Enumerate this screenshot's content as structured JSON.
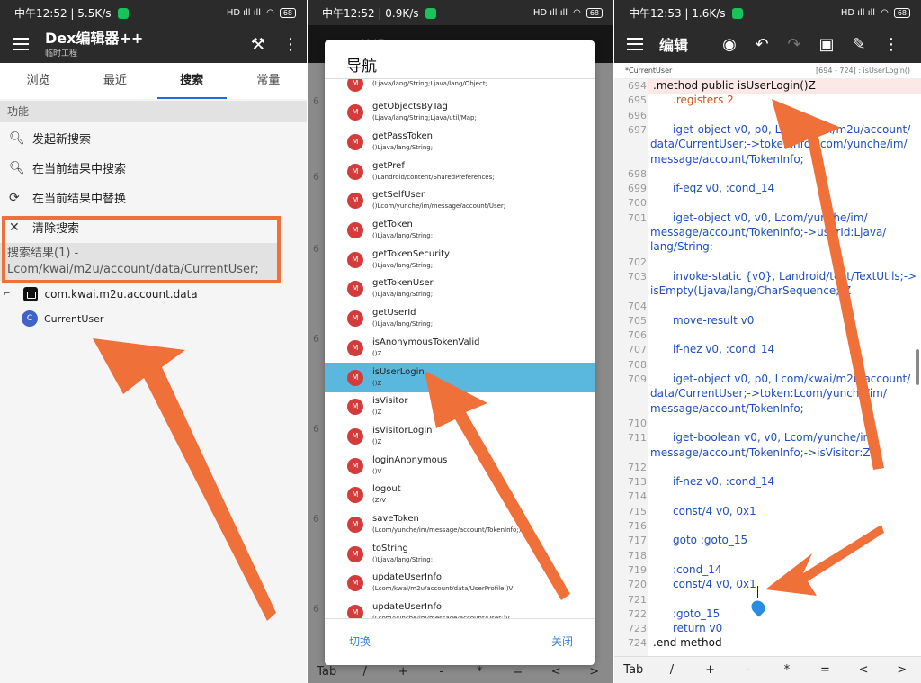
{
  "panel1": {
    "status": {
      "time": "中午12:52 | 5.5K/s",
      "signal": "HD ıll ıll",
      "battery": "68"
    },
    "app_title": "Dex编辑器++",
    "app_subtitle": "临时工程",
    "tabs": [
      "浏览",
      "最近",
      "搜索",
      "常量"
    ],
    "section_title": "功能",
    "functions": [
      {
        "label": "发起新搜索",
        "icon": "search-icon"
      },
      {
        "label": "在当前结果中搜索",
        "icon": "search-icon"
      },
      {
        "label": "在当前结果中替换",
        "icon": "replace-icon"
      },
      {
        "label": "清除搜索",
        "icon": "close-icon"
      }
    ],
    "result_text": "搜索结果(1) - Lcom/kwai/m2u/account/data/CurrentUser;",
    "tree_package": "com.kwai.m2u.account.data",
    "tree_class_badge": "C",
    "tree_class": "CurrentUser"
  },
  "panel2": {
    "status": {
      "time": "中午12:52 | 0.9K/s",
      "signal": "HD ıll ıll",
      "battery": "68"
    },
    "dialog_title": "导航",
    "badge": "M",
    "items": [
      {
        "name": "",
        "sig": "(Ljava/lang/String;Ljava/lang/Object;"
      },
      {
        "name": "getObjectsByTag",
        "sig": "(Ljava/lang/String;Ljava/util/Map;"
      },
      {
        "name": "getPassToken",
        "sig": "()Ljava/lang/String;"
      },
      {
        "name": "getPref",
        "sig": "()Landroid/content/SharedPreferences;"
      },
      {
        "name": "getSelfUser",
        "sig": "()Lcom/yunche/im/message/account/User;"
      },
      {
        "name": "getToken",
        "sig": "()Ljava/lang/String;"
      },
      {
        "name": "getTokenSecurity",
        "sig": "()Ljava/lang/String;"
      },
      {
        "name": "getTokenUser",
        "sig": "()Ljava/lang/String;"
      },
      {
        "name": "getUserId",
        "sig": "()Ljava/lang/String;"
      },
      {
        "name": "isAnonymousTokenValid",
        "sig": "()Z"
      },
      {
        "name": "isUserLogin",
        "sig": "()Z"
      },
      {
        "name": "isVisitor",
        "sig": "()Z"
      },
      {
        "name": "isVisitorLogin",
        "sig": "()Z"
      },
      {
        "name": "loginAnonymous",
        "sig": "()V"
      },
      {
        "name": "logout",
        "sig": "(Z)V"
      },
      {
        "name": "saveToken",
        "sig": "(Lcom/yunche/im/message/account/TokenInfo;)V"
      },
      {
        "name": "toString",
        "sig": "()Ljava/lang/String;"
      },
      {
        "name": "updateUserInfo",
        "sig": "(Lcom/kwai/m2u/account/data/UserProfile;)V"
      },
      {
        "name": "updateUserInfo",
        "sig": "(Lcom/yunche/im/message/account/User;)V"
      }
    ],
    "switch_label": "切换",
    "close_label": "关闭",
    "bg_toolbar_title": "编辑",
    "bg_line_prefix": "6",
    "bg_keys": [
      "Tab",
      "/",
      "+",
      "-",
      "*",
      "=",
      "<",
      ">"
    ]
  },
  "panel3": {
    "status": {
      "time": "中午12:53 | 1.6K/s",
      "signal": "HD ıll ıll",
      "battery": "68"
    },
    "toolbar_title": "编辑",
    "file_name": "*CurrentUser",
    "line_range": "[694 - 724] : isUserLogin()",
    "lines": [
      {
        "n": "694",
        "text": ".method public isUserLogin()Z",
        "cls": "black"
      },
      {
        "n": "695",
        "text": ".registers 2",
        "cls": "orange"
      },
      {
        "n": "696",
        "text": "",
        "cls": ""
      },
      {
        "n": "697",
        "text": "iget-object v0, p0, Lcom/kwai/m2u/account/",
        "cls": ""
      },
      {
        "n": "",
        "text": "data/CurrentUser;->tokenInfo:Lcom/yunche/im/",
        "cls": "cont"
      },
      {
        "n": "",
        "text": "message/account/TokenInfo;",
        "cls": "cont"
      },
      {
        "n": "698",
        "text": "",
        "cls": ""
      },
      {
        "n": "699",
        "text": "if-eqz v0, :cond_14",
        "cls": ""
      },
      {
        "n": "700",
        "text": "",
        "cls": ""
      },
      {
        "n": "701",
        "text": "iget-object v0, v0, Lcom/yunche/im/",
        "cls": ""
      },
      {
        "n": "",
        "text": "message/account/TokenInfo;->userId:Ljava/",
        "cls": "cont"
      },
      {
        "n": "",
        "text": "lang/String;",
        "cls": "cont"
      },
      {
        "n": "702",
        "text": "",
        "cls": ""
      },
      {
        "n": "703",
        "text": "invoke-static {v0}, Landroid/text/TextUtils;->",
        "cls": ""
      },
      {
        "n": "",
        "text": "isEmpty(Ljava/lang/CharSequence;)Z",
        "cls": "cont"
      },
      {
        "n": "704",
        "text": "",
        "cls": ""
      },
      {
        "n": "705",
        "text": "move-result v0",
        "cls": ""
      },
      {
        "n": "706",
        "text": "",
        "cls": ""
      },
      {
        "n": "707",
        "text": "if-nez v0, :cond_14",
        "cls": ""
      },
      {
        "n": "708",
        "text": "",
        "cls": ""
      },
      {
        "n": "709",
        "text": "iget-object v0, p0, Lcom/kwai/m2u/account/",
        "cls": ""
      },
      {
        "n": "",
        "text": "data/CurrentUser;->token:Lcom/yunche/im/",
        "cls": "cont"
      },
      {
        "n": "",
        "text": "message/account/TokenInfo;",
        "cls": "cont"
      },
      {
        "n": "710",
        "text": "",
        "cls": ""
      },
      {
        "n": "711",
        "text": "iget-boolean v0, v0, Lcom/yunche/im/",
        "cls": ""
      },
      {
        "n": "",
        "text": "message/account/TokenInfo;->isVisitor:Z",
        "cls": "cont"
      },
      {
        "n": "712",
        "text": "",
        "cls": ""
      },
      {
        "n": "713",
        "text": "if-nez v0, :cond_14",
        "cls": ""
      },
      {
        "n": "714",
        "text": "",
        "cls": ""
      },
      {
        "n": "715",
        "text": "const/4 v0, 0x1",
        "cls": ""
      },
      {
        "n": "716",
        "text": "",
        "cls": ""
      },
      {
        "n": "717",
        "text": "goto :goto_15",
        "cls": ""
      },
      {
        "n": "718",
        "text": "",
        "cls": ""
      },
      {
        "n": "719",
        "text": ":cond_14",
        "cls": ""
      },
      {
        "n": "720",
        "text": "const/4 v0, 0x1",
        "cls": ""
      },
      {
        "n": "721",
        "text": "",
        "cls": ""
      },
      {
        "n": "722",
        "text": ":goto_15",
        "cls": ""
      },
      {
        "n": "723",
        "text": "return v0",
        "cls": ""
      },
      {
        "n": "724",
        "text": ".end method",
        "cls": "black"
      }
    ],
    "keys": [
      "Tab",
      "/",
      "+",
      "-",
      "*",
      "=",
      "<",
      ">"
    ]
  },
  "colors": {
    "accent_blue": "#1e6fd9",
    "arrow_orange": "#f0703a",
    "selected_item": "#5ab8df",
    "method_badge": "#d43c3c"
  }
}
